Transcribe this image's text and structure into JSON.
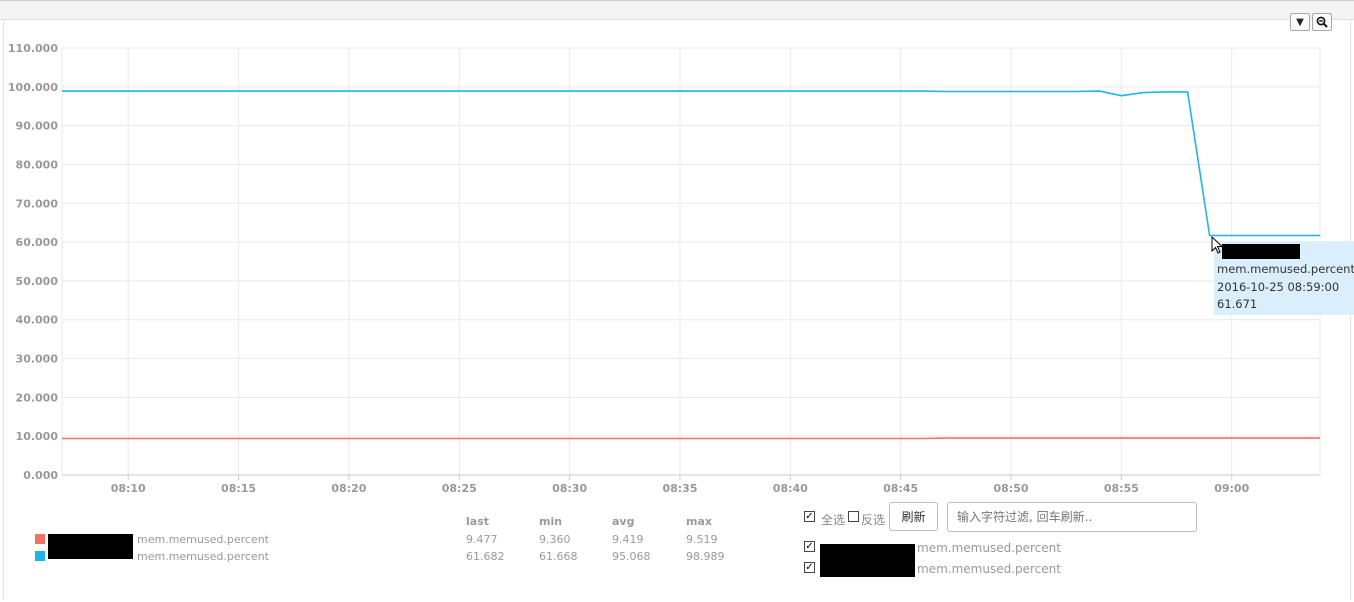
{
  "toolbar": {
    "dropdown_icon": "caret-down-icon",
    "zoom_icon": "zoom-out-icon"
  },
  "colors": {
    "series_red": "#f27266",
    "series_blue": "#1cb5ec",
    "grid": "#e9e9e9",
    "axis_text": "#999999"
  },
  "tooltip": {
    "series": "mem.memused.percent",
    "time": "2016-10-25 08:59:00",
    "value": "61.671"
  },
  "legend": {
    "headers": [
      "last",
      "min",
      "avg",
      "max"
    ],
    "rows": [
      {
        "metric": "mem.memused.percent",
        "color": "#f27266",
        "last": "9.477",
        "min": "9.360",
        "avg": "9.419",
        "max": "9.519"
      },
      {
        "metric": "mem.memused.percent",
        "color": "#1cb5ec",
        "last": "61.682",
        "min": "61.668",
        "avg": "95.068",
        "max": "98.989"
      }
    ]
  },
  "controls": {
    "select_all_label": "全选",
    "invert_label": "反选",
    "refresh_label": "刷新",
    "filter_placeholder": "输入字符过滤, 回车刷新..",
    "series_list": [
      "mem.memused.percent",
      "mem.memused.percent"
    ]
  },
  "chart_data": {
    "type": "line",
    "xlabel": "",
    "ylabel": "",
    "ylim": [
      0,
      110
    ],
    "y_ticks": [
      "0.000",
      "10.000",
      "20.000",
      "30.000",
      "40.000",
      "50.000",
      "60.000",
      "70.000",
      "80.000",
      "90.000",
      "100.000",
      "110.000"
    ],
    "x_ticks": [
      "08:10",
      "08:15",
      "08:20",
      "08:25",
      "08:30",
      "08:35",
      "08:40",
      "08:45",
      "08:50",
      "08:55",
      "09:00"
    ],
    "x_range": [
      "08:07",
      "09:04"
    ],
    "grid": true,
    "series": [
      {
        "color": "#1cb5ec",
        "points": [
          [
            "08:07",
            98.9
          ],
          [
            "08:20",
            98.9
          ],
          [
            "08:35",
            98.9
          ],
          [
            "08:46",
            98.9
          ],
          [
            "08:47",
            98.8
          ],
          [
            "08:53",
            98.8
          ],
          [
            "08:54",
            98.9
          ],
          [
            "08:55",
            97.7
          ],
          [
            "08:56",
            98.5
          ],
          [
            "08:57",
            98.7
          ],
          [
            "08:58",
            98.7
          ],
          [
            "08:59",
            61.7
          ],
          [
            "09:04",
            61.7
          ]
        ]
      },
      {
        "color": "#f27266",
        "points": [
          [
            "08:07",
            9.4
          ],
          [
            "08:20",
            9.4
          ],
          [
            "08:35",
            9.4
          ],
          [
            "08:46",
            9.4
          ],
          [
            "08:47",
            9.5
          ],
          [
            "08:55",
            9.5
          ],
          [
            "09:04",
            9.5
          ]
        ]
      }
    ]
  }
}
